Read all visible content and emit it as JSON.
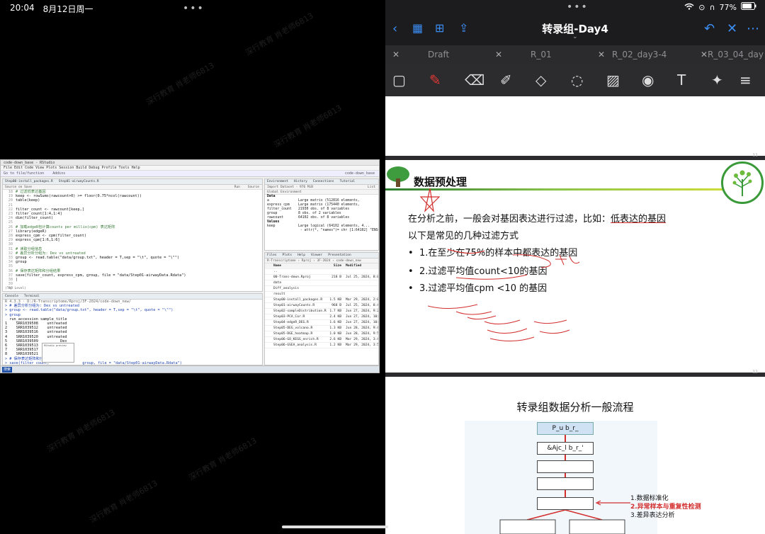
{
  "status": {
    "time": "20:04",
    "date": "8月12日周一",
    "battery": "77%"
  },
  "watermark": "深行教育  肖老师6813",
  "rstudio": {
    "window_title": "code-down_base - RStudio",
    "menu": "File  Edit  Code  View  Plots  Session  Build  Debug  Profile  Tools  Help",
    "toolbar_addins": "Go to file/function",
    "toolbar_addins_btn": "Addins",
    "project": "code-down_base",
    "editor_tabs": [
      "Step00-install_packages.R",
      "Step01-airwayCounts.R"
    ],
    "editor_subbar": "Source on Save",
    "run_label": "Run",
    "source_label": "Source",
    "code": [
      {
        "n": "18",
        "t": "# 过滤低表达基因",
        "c": true
      },
      {
        "n": "19",
        "t": "keep <- rowSums(rawcount>0) >= floor(0.75*ncol(rawcount))",
        "c": false
      },
      {
        "n": "20",
        "t": "table(keep)",
        "c": false
      },
      {
        "n": "21",
        "t": "",
        "c": false
      },
      {
        "n": "22",
        "t": "filter_count <- rawcount[keep,]",
        "c": false
      },
      {
        "n": "23",
        "t": "filter_count[1:4,1:4]",
        "c": false
      },
      {
        "n": "24",
        "t": "dim(filter_count)",
        "c": false
      },
      {
        "n": "25",
        "t": "",
        "c": false
      },
      {
        "n": "26",
        "t": "# 加载edgeR包计算counts per millio(cpm) 表达矩阵",
        "c": true
      },
      {
        "n": "27",
        "t": "library(edgeR)",
        "c": false
      },
      {
        "n": "28",
        "t": "express_cpm <- cpm(filter_count)",
        "c": false
      },
      {
        "n": "29",
        "t": "express_cpm[1:6,1:6]",
        "c": false
      },
      {
        "n": "30",
        "t": "",
        "c": false
      },
      {
        "n": "31",
        "t": "# 读取分组信息",
        "c": true
      },
      {
        "n": "32",
        "t": "# 差异分析分组为: Dex vs untreated",
        "c": true
      },
      {
        "n": "33",
        "t": "group <- read.table(\"data/group.txt\", header = T,sep = \"\\t\", quote = \"\\\"\")",
        "c": false
      },
      {
        "n": "34",
        "t": "group",
        "c": false
      },
      {
        "n": "35",
        "t": "",
        "c": false
      },
      {
        "n": "36",
        "t": "# 保存表达矩阵和分组结果",
        "c": true
      },
      {
        "n": "37",
        "t": "save(filter_count, express_cpm, group, file = \"data/Step01-airwayData.Rdata\")",
        "c": false
      },
      {
        "n": "38",
        "t": "|",
        "c": false
      },
      {
        "n": "39",
        "t": "",
        "c": false
      },
      {
        "n": "40",
        "t": "",
        "c": false
      },
      {
        "n": "41",
        "t": "",
        "c": false
      }
    ],
    "editor_status": "(Top Level)",
    "console_tabs": [
      "Console",
      "Terminal"
    ],
    "console_path": "R 4.3.3 · D:/R-Transcriptome/Rproj/3F-2024/code-down_new/",
    "console": [
      {
        "t": "> # 差异分析分组为: Dex vs untreated",
        "b": true
      },
      {
        "t": "> group <- read.table(\"data/group.txt\", header = T,sep = \"\\t\", quote = \"\\\"\")",
        "b": true
      },
      {
        "t": "> group",
        "b": true
      },
      {
        "t": "  run_accession sample_title",
        "b": false
      },
      {
        "t": "1    SRR1039508    untreated",
        "b": false
      },
      {
        "t": "2    SRR1039512    untreated",
        "b": false
      },
      {
        "t": "3    SRR1039516    untreated",
        "b": false
      },
      {
        "t": "4    SRR1039520    untreated",
        "b": false
      },
      {
        "t": "5    SRR1039509          Dex",
        "b": false
      },
      {
        "t": "6    SRR1039513          Dex",
        "b": false
      },
      {
        "t": "7    SRR1039517          Dex",
        "b": false
      },
      {
        "t": "8    SRR1039521          Dex",
        "b": false
      },
      {
        "t": "> # 保存表达矩阵和分组结果",
        "b": true
      },
      {
        "t": "> save(filter_count,               group, file = \"data/Step01-airwayData.Rdata\")",
        "b": true
      },
      {
        "t": ">",
        "b": true
      }
    ],
    "env_tabs": [
      "Environment",
      "History",
      "Connections",
      "Tutorial"
    ],
    "env_subbar": "Import Dataset  ·  976 MiB",
    "env_scope": "Global Environment",
    "env_list_label": "List",
    "env_data_header": "Data",
    "env_data": [
      {
        "n": "a",
        "v": "Large matrix (512816 elements,"
      },
      {
        "n": "express_cpm",
        "v": "Large matrix (175440 elements,"
      },
      {
        "n": "filter_count",
        "v": "21930 obs. of 8 variables"
      },
      {
        "n": "group",
        "v": "8 obs. of 2 variables"
      },
      {
        "n": "rawcount",
        "v": "64102 obs. of 8 variables"
      }
    ],
    "env_values_header": "Values",
    "env_values": [
      {
        "n": "keep",
        "v": "Large logical (64102 elements, 4..."
      },
      {
        "n": "",
        "v": " - attr(*, \"names\")= chr [1:64102] \"ENSG0000000..."
      }
    ],
    "files_tabs": [
      "Files",
      "Plots",
      "Help",
      "Viewer",
      "Presentation"
    ],
    "files_path": "R-Transcriptome › Rproj › 3F-2024 › code-down_new",
    "files_cols": [
      "Name",
      "Size",
      "Modified"
    ],
    "files": [
      {
        "n": "..",
        "s": "",
        "m": ""
      },
      {
        "n": "00-Trans-down.Rproj",
        "s": "218 B",
        "m": "Jul 25, 2024, 8:04"
      },
      {
        "n": "data",
        "s": "",
        "m": ""
      },
      {
        "n": "Diff_analysis",
        "s": "",
        "m": ""
      },
      {
        "n": "result",
        "s": "",
        "m": ""
      },
      {
        "n": "Step00-install_packages.R",
        "s": "1.5 KB",
        "m": "Mar 29, 2024, 2:0"
      },
      {
        "n": "Step01-airwayCounts.R",
        "s": "968 B",
        "m": "Jul 25, 2024, 8:47"
      },
      {
        "n": "Step02-sampleDistribution.R",
        "s": "1.7 KB",
        "m": "Jun 27, 2024, 9:25"
      },
      {
        "n": "Step03-PCA_Cor.R",
        "s": "2.4 KB",
        "m": "Jun 27, 2024, 10:3"
      },
      {
        "n": "Step04-edgeR_DEG.R",
        "s": "1.6 KB",
        "m": "Jun 27, 2024, 10:4"
      },
      {
        "n": "Step05-DEG_volcano.R",
        "s": "1.3 KB",
        "m": "Jun 28, 2024, 9:45"
      },
      {
        "n": "Step05-DGE_heatmap.R",
        "s": "1.0 KB",
        "m": "Jun 28, 2024, 9:50"
      },
      {
        "n": "Step06-GO_KEGG_enrich.R",
        "s": "2.6 KB",
        "m": "Mar 29, 2024, 3:4"
      },
      {
        "n": "Step06-GSEA_analysis.R",
        "s": "1.2 KB",
        "m": "Mar 29, 2024, 3:5"
      }
    ],
    "taskbar_start": "搜索"
  },
  "notes": {
    "title": "转录组-Day4",
    "tabs": [
      "Draft",
      "R_01",
      "R_02_day3-4",
      "R_03_04_day"
    ],
    "page1_number": "11",
    "page2_number": "12",
    "page2_title": "数据预处理",
    "page2_intro_a": "在分析之前，一般会对基因表达进行过滤，比如：",
    "page2_intro_b": "低表达的基因",
    "page2_intro_2": "以下是常见的几种过滤方式",
    "bullets": [
      "1.在至少在75%的样本中都表达的基因",
      "2.过滤平均值count<10的基因",
      "3.过滤平均值cpm <10 的基因"
    ],
    "page3_title": "转录组数据分析一般流程",
    "flow_boxes": [
      "P_u b_r_",
      "&Ajc_l b_r_'"
    ],
    "flow_labels": [
      "1.数据标准化",
      "2.异常样本与重复性检测",
      "3.差异表达分析"
    ]
  }
}
